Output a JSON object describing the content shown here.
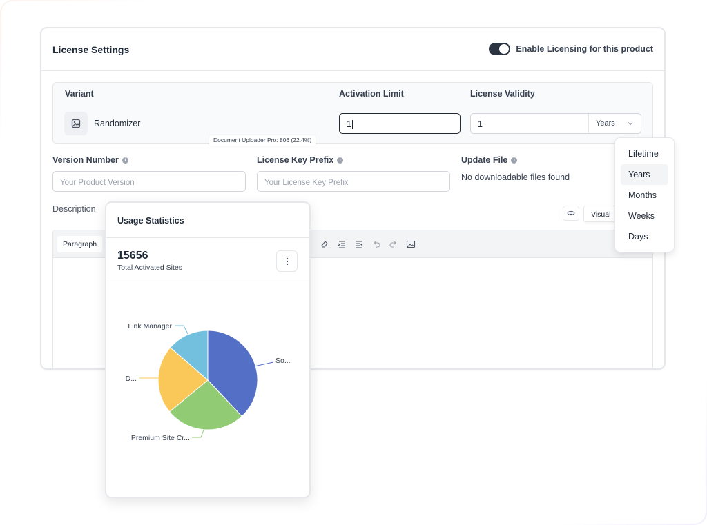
{
  "header": {
    "title": "License Settings",
    "toggle_label": "Enable Licensing for this product",
    "toggle_on": true
  },
  "variant_table": {
    "col_variant": "Variant",
    "col_activation": "Activation Limit",
    "col_validity": "License Validity",
    "variant_name": "Randomizer",
    "activation_value": "1",
    "validity_value": "1",
    "validity_unit": "Years"
  },
  "tooltip": "Document Uploader Pro: 806 (22.4%)",
  "fields": {
    "version_label": "Version Number",
    "version_placeholder": "Your Product Version",
    "prefix_label": "License Key Prefix",
    "prefix_placeholder": "Your License Key Prefix",
    "update_label": "Update File",
    "update_value": "No downloadable files found",
    "description_label": "Description"
  },
  "editor": {
    "visual_label": "Visual",
    "format_label": "Paragraph"
  },
  "validity_dropdown": {
    "options": [
      "Lifetime",
      "Years",
      "Months",
      "Weeks",
      "Days"
    ],
    "selected": "Years"
  },
  "stats": {
    "title": "Usage Statistics",
    "total_value": "15656",
    "total_label": "Total Activated Sites"
  },
  "colors": {
    "toggle": "#2b3440",
    "pie_blue": "#5470c6",
    "pie_green": "#91cc75",
    "pie_yellow": "#fac858",
    "pie_cyan": "#73c0de"
  },
  "chart_data": {
    "type": "pie",
    "title": "",
    "slices": [
      {
        "label": "So...",
        "value": 38,
        "color": "#5470c6"
      },
      {
        "label": "Premium Site Cr...",
        "value": 26,
        "color": "#91cc75"
      },
      {
        "label": "D...",
        "value": 22.4,
        "color": "#fac858"
      },
      {
        "label": "Link Manager",
        "value": 13.6,
        "color": "#73c0de"
      }
    ]
  }
}
